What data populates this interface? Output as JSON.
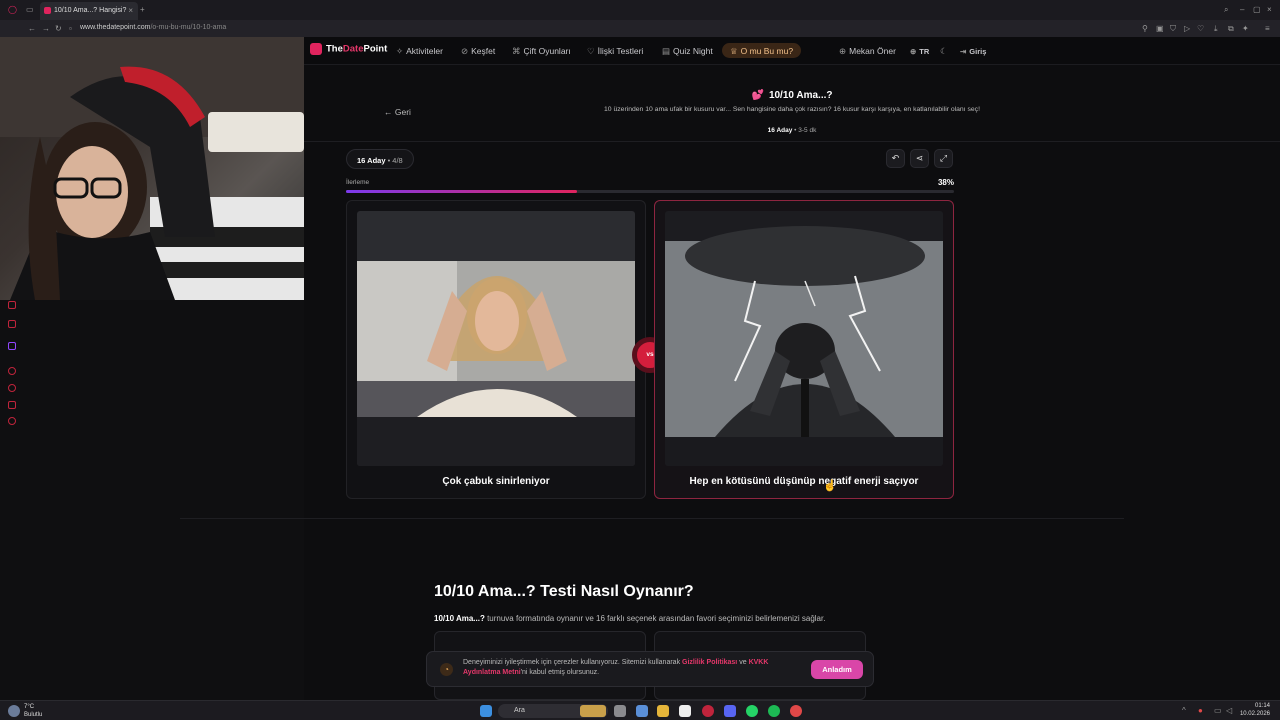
{
  "browser": {
    "tab_title": "10/10 Ama...? Hangisi?",
    "url_domain": "www.thedatepoint.com",
    "url_path": "/o-mu-bu-mu/10-10-ama"
  },
  "site": {
    "logo_prefix": "The",
    "logo_accent": "Date",
    "logo_suffix": "Point",
    "nav": {
      "activities": "Aktiviteler",
      "explore": "Keşfet",
      "couple_games": "Çift Oyunları",
      "relationship_tests": "İlişki Testleri",
      "quiz_night": "Quiz Night",
      "this_or_that": "O mu Bu mu?",
      "suggest_place": "Mekan Öner",
      "language": "TR",
      "login": "Giriş"
    }
  },
  "game": {
    "back_label": "Geri",
    "title": "10/10 Ama...?",
    "description": "10 üzerinden 10 ama ufak bir kusuru var... Sen hangisine daha çok razısın? 16 kusur karşı karşıya, en katlanılabilir olanı seç!",
    "candidates": "16 Aday",
    "duration": "3-5 dk",
    "round_candidates": "16 Aday",
    "round_step": "4/8",
    "progress_label": "İlerleme",
    "progress_pct_text": "38%",
    "progress_value": 0.38,
    "vs_label": "vs",
    "option_left": "Çok çabuk sinirleniyor",
    "option_right": "Hep en kötüsünü düşünüp negatif enerji saçıyor"
  },
  "howto": {
    "title": "10/10 Ama...? Testi Nasıl Oynanır?",
    "desc_bold": "10/10 Ama...?",
    "desc_rest": " turnuva formatında oynanır ve 16 farklı seçenek arasından favori seçiminizi belirlemenizi sağlar."
  },
  "cookie": {
    "text1": "Deneyiminizi iyileştirmek için çerezler kullanıyoruz. Sitemizi kullanarak ",
    "privacy_link": "Gizlilik Politikası",
    "and": " ve ",
    "kvkk_link": "KVKK Aydınlatma Metni",
    "text2": "'ni kabul etmiş olursunuz.",
    "accept": "Anladım"
  },
  "taskbar": {
    "search_label": "Ara",
    "weather_temp": "7°C",
    "weather_desc": "Bulutlu",
    "time": "01:14",
    "date": "10.02.2026"
  },
  "colors": {
    "brand": "#e0245e",
    "accent_purple": "#7c3aed",
    "accept_button": "#d946a8"
  }
}
